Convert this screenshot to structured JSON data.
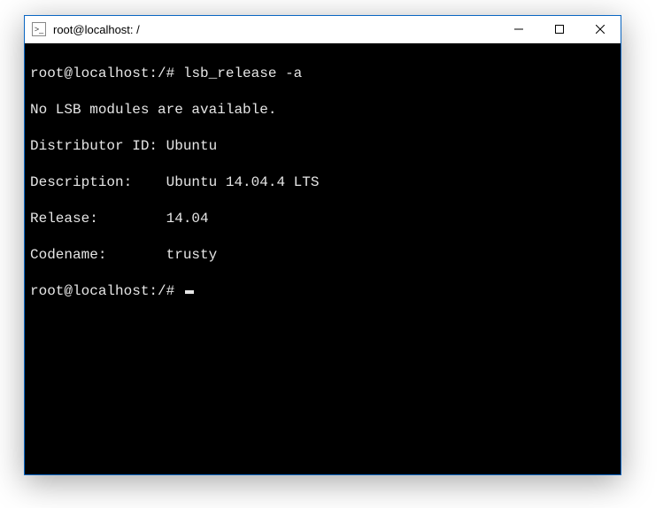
{
  "window": {
    "title": "root@localhost: /"
  },
  "terminal": {
    "prompt": "root@localhost:/#",
    "command": "lsb_release -a",
    "lines": {
      "lsb_warning": "No LSB modules are available.",
      "distributor": "Distributor ID: Ubuntu",
      "description": "Description:    Ubuntu 14.04.4 LTS",
      "release": "Release:        14.04",
      "codename": "Codename:       trusty"
    }
  }
}
